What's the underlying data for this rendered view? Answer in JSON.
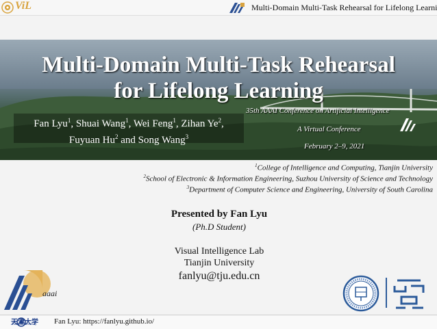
{
  "header": {
    "logo_text": "ViL",
    "title": "Multi-Domain Multi-Task Rehearsal for Lifelong Learning"
  },
  "banner": {
    "title_line1": "Multi-Domain Multi-Task Rehearsal",
    "title_line2": "for Lifelong Learning",
    "authors": [
      {
        "name": "Fan Lyu",
        "sup": "1"
      },
      {
        "name": "Shuai Wang",
        "sup": "1"
      },
      {
        "name": "Wei Feng",
        "sup": "1"
      },
      {
        "name": "Zihan Ye",
        "sup": "2"
      },
      {
        "name": "Fuyuan Hu",
        "sup": "2"
      },
      {
        "name": "Song Wang",
        "sup": "3"
      }
    ],
    "conference": "35th AAAI Conference on Artificial Intelligence",
    "venue": "A Virtual Conference",
    "dates": "February 2–9, 2021"
  },
  "affiliations": [
    {
      "sup": "1",
      "text": "College of Intelligence and Computing, Tianjin University"
    },
    {
      "sup": "2",
      "text": "School of Electronic & Information Engineering, Suzhou University of Science and Technology"
    },
    {
      "sup": "3",
      "text": "Department of Computer Science and Engineering, University of South Carolina"
    }
  ],
  "presenter": {
    "presented_by": "Presented by Fan Lyu",
    "role": "(Ph.D Student)",
    "lab": "Visual Intelligence Lab",
    "university": "Tianjin University",
    "email": "fanlyu@tju.edu.cn"
  },
  "footer": {
    "tju_logo_text": "天津大学",
    "tju_logo_sub": "Tianjin University",
    "homepage": "Fan Lyu: https://fanlyu.github.io/"
  },
  "logos": {
    "aaai_text": "aaai"
  },
  "colors": {
    "aaai_blue": "#2a4f93",
    "aaai_gold": "#d9a441",
    "tju_blue": "#1f3f8a"
  }
}
